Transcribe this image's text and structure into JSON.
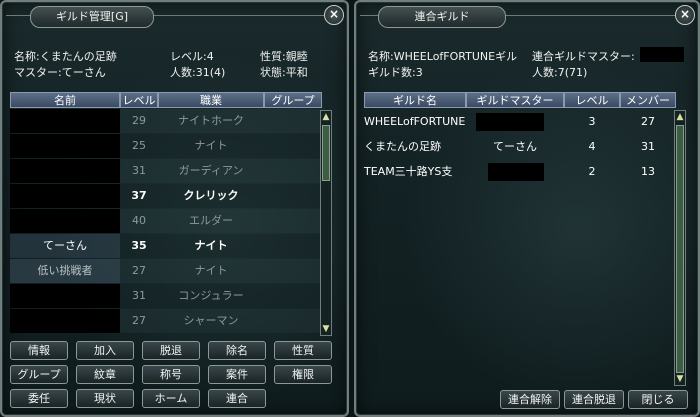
{
  "guild_panel": {
    "title": "ギルド管理[G]",
    "info": {
      "name": "名称:くまたんの足跡",
      "master": "マスター:てーさん",
      "level": "レベル:4",
      "members": "人数:31(4)",
      "nature": "性質:親睦",
      "state": "状態:平和"
    },
    "columns": [
      "名前",
      "レベル",
      "職業",
      "グループ"
    ],
    "rows": [
      {
        "name": "",
        "level": "29",
        "job": "ナイトホーク",
        "group": "",
        "online": false,
        "redacted": true
      },
      {
        "name": "",
        "level": "25",
        "job": "ナイト",
        "group": "",
        "online": false,
        "redacted": true
      },
      {
        "name": "",
        "level": "31",
        "job": "ガーディアン",
        "group": "",
        "online": false,
        "redacted": true
      },
      {
        "name": "",
        "level": "37",
        "job": "クレリック",
        "group": "",
        "online": true,
        "redacted": true
      },
      {
        "name": "",
        "level": "40",
        "job": "エルダー",
        "group": "",
        "online": false,
        "redacted": true
      },
      {
        "name": "てーさん",
        "level": "35",
        "job": "ナイト",
        "group": "",
        "online": true,
        "redacted": false
      },
      {
        "name": "低い挑戦者",
        "level": "27",
        "job": "ナイト",
        "group": "",
        "online": false,
        "redacted": false
      },
      {
        "name": "",
        "level": "31",
        "job": "コンジュラー",
        "group": "",
        "online": false,
        "redacted": true
      },
      {
        "name": "",
        "level": "27",
        "job": "シャーマン",
        "group": "",
        "online": false,
        "redacted": true
      }
    ],
    "buttons": [
      [
        "情報",
        "加入",
        "脱退",
        "除名",
        "性質"
      ],
      [
        "グループ",
        "紋章",
        "称号",
        "案件",
        "権限"
      ],
      [
        "委任",
        "現状",
        "ホーム",
        "連合"
      ]
    ]
  },
  "alliance_panel": {
    "title": "連合ギルド",
    "info": {
      "name": "名称:WHEELofFORTUNEギル",
      "master": "連合ギルドマスター:",
      "count": "ギルド数:3",
      "members": "人数:7(71)"
    },
    "columns": [
      "ギルド名",
      "ギルドマスター",
      "レベル",
      "メンバー"
    ],
    "rows": [
      {
        "guild": "WHEELofFORTUNE",
        "master": "",
        "level": "3",
        "members": "27",
        "redacted": true
      },
      {
        "guild": "くまたんの足跡",
        "master": "てーさん",
        "level": "4",
        "members": "31",
        "redacted": false
      },
      {
        "guild": "TEAM三十路YS支",
        "master": "",
        "level": "2",
        "members": "13",
        "redacted": true
      }
    ],
    "buttons": [
      "連合解除",
      "連合脱退",
      "閉じる"
    ]
  }
}
